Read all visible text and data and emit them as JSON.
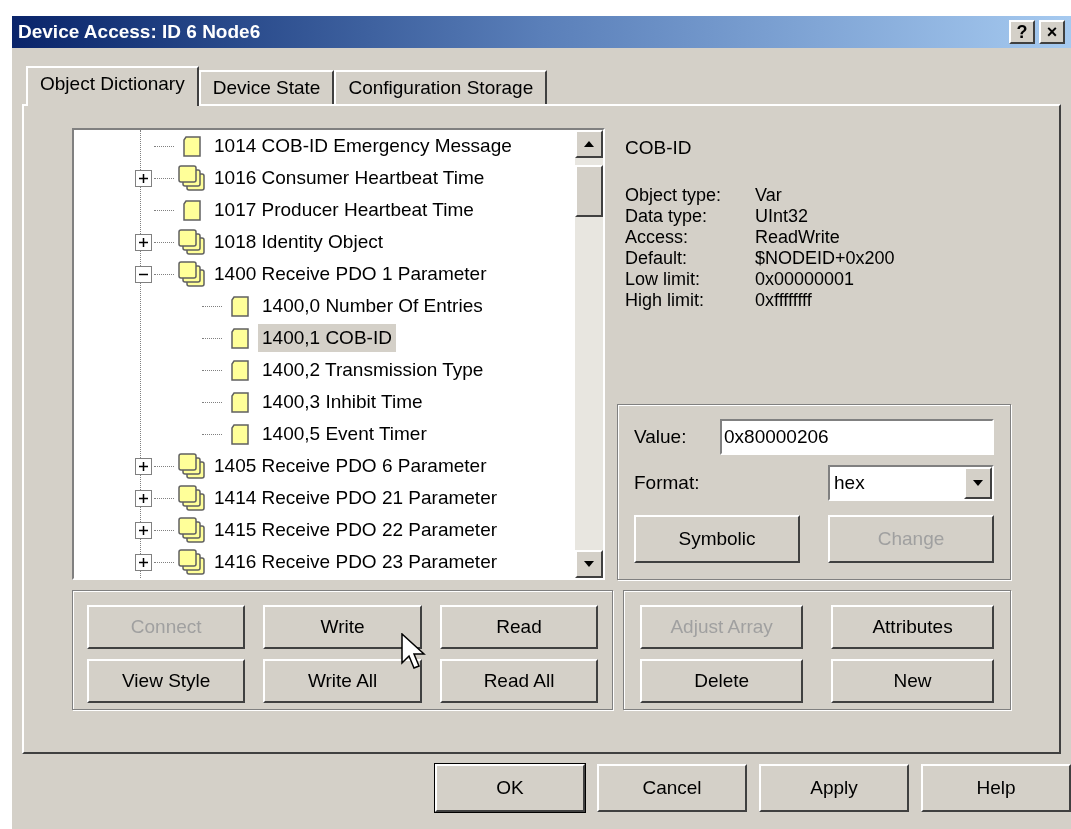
{
  "window": {
    "title": "Device Access: ID 6 Node6",
    "title_buttons": [
      "?",
      "×"
    ]
  },
  "tabs": [
    {
      "label": "Object Dictionary",
      "selected": true
    },
    {
      "label": "Device State",
      "selected": false
    },
    {
      "label": "Configuration Storage",
      "selected": false
    }
  ],
  "tree": [
    {
      "label": "1014 COB-ID Emergency Message",
      "kind": "variable",
      "selected": false
    },
    {
      "label": "1016 Consumer Heartbeat Time",
      "kind": "record",
      "expanded": false,
      "selected": false
    },
    {
      "label": "1017 Producer Heartbeat Time",
      "kind": "variable",
      "selected": false
    },
    {
      "label": "1018 Identity Object",
      "kind": "record",
      "expanded": false,
      "selected": false
    },
    {
      "label": "1400 Receive PDO 1 Parameter",
      "kind": "record",
      "expanded": true,
      "selected": false,
      "children": [
        {
          "label": "1400,0 Number Of Entries",
          "kind": "variable",
          "selected": false
        },
        {
          "label": "1400,1 COB-ID",
          "kind": "variable",
          "selected": true
        },
        {
          "label": "1400,2 Transmission Type",
          "kind": "variable",
          "selected": false
        },
        {
          "label": "1400,3 Inhibit Time",
          "kind": "variable",
          "selected": false
        },
        {
          "label": "1400,5 Event Timer",
          "kind": "variable",
          "selected": false
        }
      ]
    },
    {
      "label": "1405 Receive PDO 6 Parameter",
      "kind": "record",
      "expanded": false,
      "selected": false
    },
    {
      "label": "1414 Receive PDO 21 Parameter",
      "kind": "record",
      "expanded": false,
      "selected": false
    },
    {
      "label": "1415 Receive PDO 22 Parameter",
      "kind": "record",
      "expanded": false,
      "selected": false
    },
    {
      "label": "1416 Receive PDO 23 Parameter",
      "kind": "record",
      "expanded": false,
      "selected": false
    }
  ],
  "details": {
    "name": "COB-ID",
    "properties": [
      {
        "label": "Object type:",
        "value": "Var"
      },
      {
        "label": "Data type:",
        "value": "UInt32"
      },
      {
        "label": "Access:",
        "value": "ReadWrite"
      },
      {
        "label": "Default:",
        "value": "$NODEID+0x200"
      },
      {
        "label": "Low limit:",
        "value": "0x00000001"
      },
      {
        "label": "High limit:",
        "value": "0xffffffff"
      }
    ]
  },
  "value_group": {
    "value_label": "Value:",
    "value": "0x80000206",
    "format_label": "Format:",
    "format": "hex",
    "buttons": [
      {
        "label": "Symbolic",
        "disabled": false
      },
      {
        "label": "Change",
        "disabled": true
      }
    ]
  },
  "left_buttons": [
    {
      "label": "Connect",
      "disabled": true
    },
    {
      "label": "Write",
      "disabled": false
    },
    {
      "label": "Read",
      "disabled": false
    },
    {
      "label": "View Style",
      "disabled": false
    },
    {
      "label": "Write All",
      "disabled": false
    },
    {
      "label": "Read All",
      "disabled": false
    }
  ],
  "right_buttons": [
    {
      "label": "Adjust Array",
      "disabled": true
    },
    {
      "label": "Attributes",
      "disabled": false
    },
    {
      "label": "Delete",
      "disabled": false
    },
    {
      "label": "New",
      "disabled": false
    }
  ],
  "dialog_buttons": [
    {
      "label": "OK",
      "default": true
    },
    {
      "label": "Cancel",
      "default": false
    },
    {
      "label": "Apply",
      "default": false
    },
    {
      "label": "Help",
      "default": false
    }
  ]
}
